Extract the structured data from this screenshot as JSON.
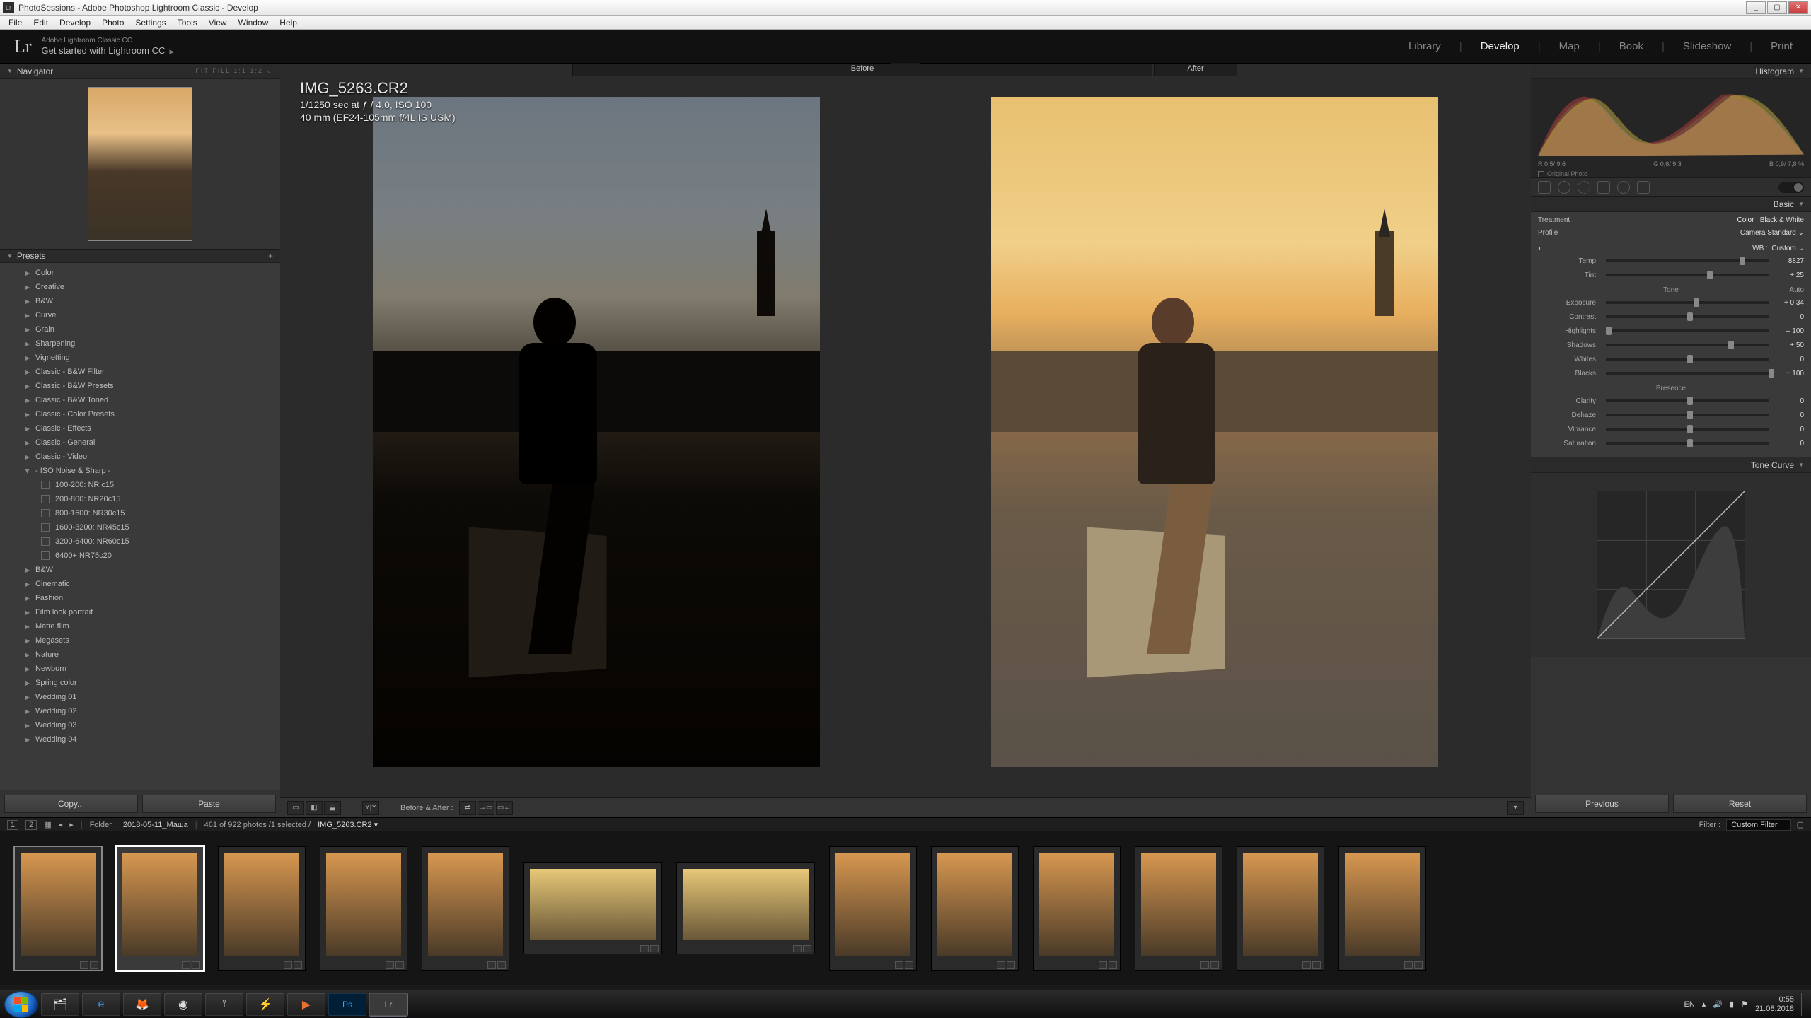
{
  "window": {
    "title": "PhotoSessions - Adobe Photoshop Lightroom Classic - Develop",
    "min": "_",
    "max": "▢",
    "close": "✕"
  },
  "menubar": [
    "File",
    "Edit",
    "Develop",
    "Photo",
    "Settings",
    "Tools",
    "View",
    "Window",
    "Help"
  ],
  "header": {
    "line1": "Adobe Lightroom Classic CC",
    "line2": "Get started with Lightroom CC"
  },
  "modules": [
    "Library",
    "Develop",
    "Map",
    "Book",
    "Slideshow",
    "Print"
  ],
  "active_module": "Develop",
  "navigator": {
    "title": "Navigator",
    "zoom_opts": "FIT   FILL   1:1   1:2 ⌄"
  },
  "presets": {
    "title": "Presets",
    "groups": [
      "Color",
      "Creative",
      "B&W",
      "Curve",
      "Grain",
      "Sharpening",
      "Vignetting",
      "Classic - B&W Filter",
      "Classic - B&W Presets",
      "Classic - B&W Toned",
      "Classic - Color Presets",
      "Classic - Effects",
      "Classic - General",
      "Classic - Video"
    ],
    "open_group": "- ISO Noise & Sharp -",
    "open_items": [
      "100-200: NR c15",
      "200-800: NR20c15",
      "800-1600: NR30c15",
      "1600-3200: NR45c15",
      "3200-6400: NR60c15",
      "6400+ NR75c20"
    ],
    "groups_after": [
      "B&W",
      "Cinematic",
      "Fashion",
      "Film look portrait",
      "Matte film",
      "Megasets",
      "Nature",
      "Newborn",
      "Spring color",
      "Wedding 01",
      "Wedding 02",
      "Wedding 03",
      "Wedding 04"
    ]
  },
  "copy_btn": "Copy...",
  "paste_btn": "Paste",
  "compare": {
    "before": "Before",
    "after": "After"
  },
  "image_info": {
    "filename": "IMG_5263.CR2",
    "exposure": "1/1250 sec at ƒ / 4.0, ISO 100",
    "lens": "40 mm (EF24-105mm f/4L IS USM)"
  },
  "center_toolbar": {
    "before_after_label": "Before & After :"
  },
  "histogram": {
    "title": "Histogram",
    "readout": [
      "R 0,5/ 9,6",
      "G 0,6/ 9,3",
      "B 0,9/ 7,8 %"
    ],
    "original_photo": "Original Photo"
  },
  "basic": {
    "title": "Basic",
    "treatment_label": "Treatment :",
    "treatment_color": "Color",
    "treatment_bw": "Black & White",
    "profile_label": "Profile :",
    "profile_value": "Camera Standard ⌄",
    "wb_label": "WB :",
    "wb_value": "Custom ⌄",
    "rows": [
      {
        "label": "Temp",
        "val": "8827",
        "pos": 82
      },
      {
        "label": "Tint",
        "val": "+ 25",
        "pos": 62
      }
    ],
    "tone_label": "Tone",
    "auto": "Auto",
    "tone_rows": [
      {
        "label": "Exposure",
        "val": "+ 0,34",
        "pos": 54
      },
      {
        "label": "Contrast",
        "val": "0",
        "pos": 50
      },
      {
        "label": "Highlights",
        "val": "– 100",
        "pos": 0
      },
      {
        "label": "Shadows",
        "val": "+ 50",
        "pos": 75
      },
      {
        "label": "Whites",
        "val": "0",
        "pos": 50
      },
      {
        "label": "Blacks",
        "val": "+ 100",
        "pos": 100
      }
    ],
    "presence_label": "Presence",
    "presence_rows": [
      {
        "label": "Clarity",
        "val": "0",
        "pos": 50
      },
      {
        "label": "Dehaze",
        "val": "0",
        "pos": 50
      },
      {
        "label": "Vibrance",
        "val": "0",
        "pos": 50
      },
      {
        "label": "Saturation",
        "val": "0",
        "pos": 50
      }
    ]
  },
  "tonecurve": {
    "title": "Tone Curve"
  },
  "prev_btn": "Previous",
  "reset_btn": "Reset",
  "filmstrip_bar": {
    "folder_label": "Folder :",
    "folder": "2018-05-11_Маша",
    "count": "461 of 922 photos /1 selected /",
    "current": "IMG_5263.CR2 ▾",
    "filter_label": "Filter :",
    "filter_value": "Custom Filter"
  },
  "taskbar": {
    "lang": "EN",
    "time": "0:55",
    "date": "21.08.2018"
  }
}
